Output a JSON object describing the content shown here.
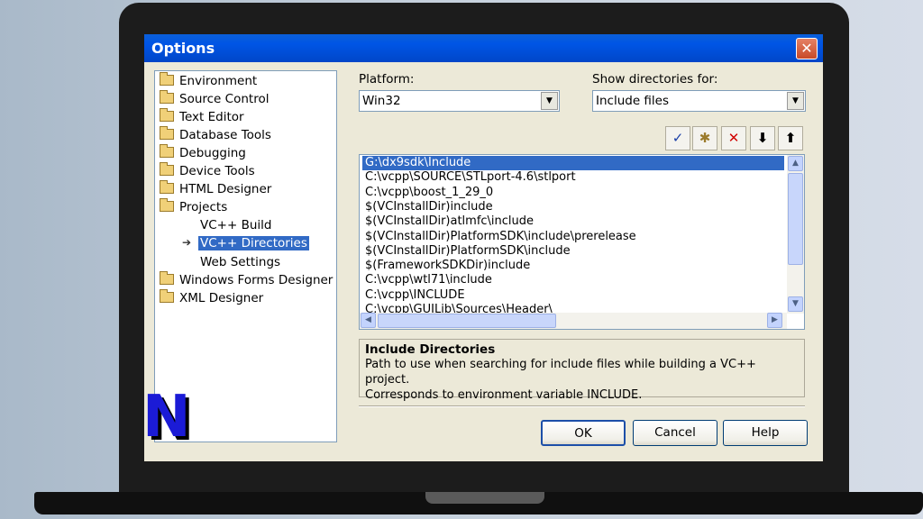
{
  "window": {
    "title": "Options",
    "close_glyph": "✕"
  },
  "tree": {
    "items": [
      {
        "label": "Environment",
        "icon": "folder-icon"
      },
      {
        "label": "Source Control",
        "icon": "folder-icon"
      },
      {
        "label": "Text Editor",
        "icon": "folder-icon"
      },
      {
        "label": "Database Tools",
        "icon": "folder-icon"
      },
      {
        "label": "Debugging",
        "icon": "folder-icon"
      },
      {
        "label": "Device Tools",
        "icon": "folder-icon"
      },
      {
        "label": "HTML Designer",
        "icon": "folder-icon"
      },
      {
        "label": "Projects",
        "icon": "folder-open-icon"
      },
      {
        "label": "VC++ Build"
      },
      {
        "label": "VC++ Directories",
        "selected": true
      },
      {
        "label": "Web Settings"
      },
      {
        "label": "Windows Forms Designer",
        "icon": "folder-icon"
      },
      {
        "label": "XML Designer",
        "icon": "folder-icon"
      }
    ]
  },
  "platform": {
    "label": "Platform:",
    "value": "Win32"
  },
  "show_dirs": {
    "label": "Show directories for:",
    "value": "Include files"
  },
  "toolbar": {
    "check_glyph": "✓",
    "new_folder_glyph": "✱",
    "delete_glyph": "✕",
    "down_glyph": "⬇",
    "up_glyph": "⬆"
  },
  "directories": [
    "G:\\dx9sdk\\Include",
    "C:\\vcpp\\SOURCE\\STLport-4.6\\stlport",
    "C:\\vcpp\\boost_1_29_0",
    "$(VCInstallDir)include",
    "$(VCInstallDir)atlmfc\\include",
    "$(VCInstallDir)PlatformSDK\\include\\prerelease",
    "$(VCInstallDir)PlatformSDK\\include",
    "$(FrameworkSDKDir)include",
    "C:\\vcpp\\wtl71\\include",
    "C:\\vcpp\\INCLUDE",
    "C:\\vcpp\\GUILib\\Sources\\Header\\"
  ],
  "description": {
    "title": "Include Directories",
    "line1": "Path to use when searching for include files while building a VC++ project.",
    "line2": "Corresponds to environment variable INCLUDE."
  },
  "buttons": {
    "ok": "OK",
    "cancel": "Cancel",
    "help": "Help"
  },
  "logo": {
    "text": "N"
  }
}
